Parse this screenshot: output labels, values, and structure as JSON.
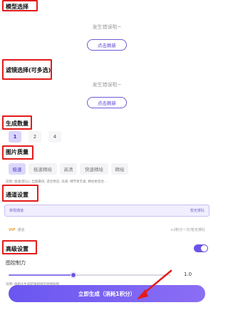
{
  "sections": {
    "model": {
      "title": "模型选择",
      "empty_text": "发生错误啦~",
      "refresh_label": "点击刷新"
    },
    "filter": {
      "title": "滤镜选择(可多选)",
      "empty_text": "发生错误啦~",
      "refresh_label": "点击刷新"
    },
    "count": {
      "title": "生成数量",
      "options": [
        "1",
        "2",
        "4"
      ],
      "selected": "1"
    },
    "quality": {
      "title": "图片质量",
      "options": [
        "极速",
        "极速精绘",
        "高清",
        "快速精绘",
        "精绘"
      ],
      "selected": "极速",
      "note": "说明: 极速(默认): 出图最快, 适合预览; 高清: 细节更丰富, 精绘更适合..."
    },
    "channel": {
      "title": "通道设置",
      "normal": {
        "label": "常规通道",
        "status": "暂无排队"
      },
      "vip": {
        "badge": "VIP",
        "label": "通道",
        "status": "+2积分一次/暂无排队"
      }
    },
    "advanced": {
      "title": "高级设置",
      "toggle_on": true,
      "control_label": "图控制力",
      "control_value": "1.0",
      "control_fraction": 0.4,
      "note": "说明: 值越大生成结果越接近原图构图"
    }
  },
  "generate_button": {
    "label": "立即生成（消耗1积分）"
  },
  "colors": {
    "accent": "#6a54e8",
    "annotation_red": "#e31b1b"
  }
}
